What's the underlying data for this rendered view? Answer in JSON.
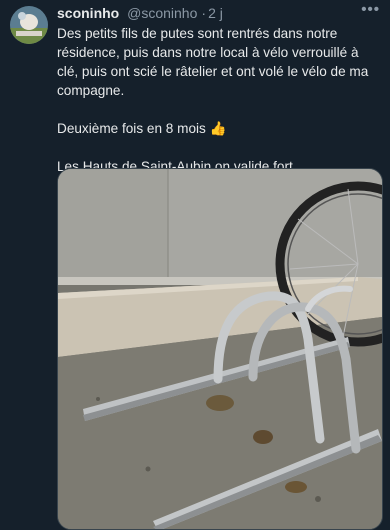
{
  "tweet": {
    "author_name": "sconinho",
    "author_handle": "@sconinho",
    "separator": "·",
    "age": "2 j",
    "more_label": "•••",
    "text_line1": "Des petits fils de putes sont rentrés dans notre résidence, puis dans notre local à vélo verrouillé à clé, puis ont scié le râtelier et ont volé le vélo de ma compagne.",
    "text_line2": "Deuxième fois en 8 mois 👍",
    "text_line3": "Les Hauts de Saint-Aubin on valide fort."
  },
  "colors": {
    "background": "#15202b",
    "text": "#e7e9ea",
    "muted": "#8b98a5",
    "border": "#38444d"
  },
  "icons": {
    "more": "more-horizontal-icon"
  }
}
